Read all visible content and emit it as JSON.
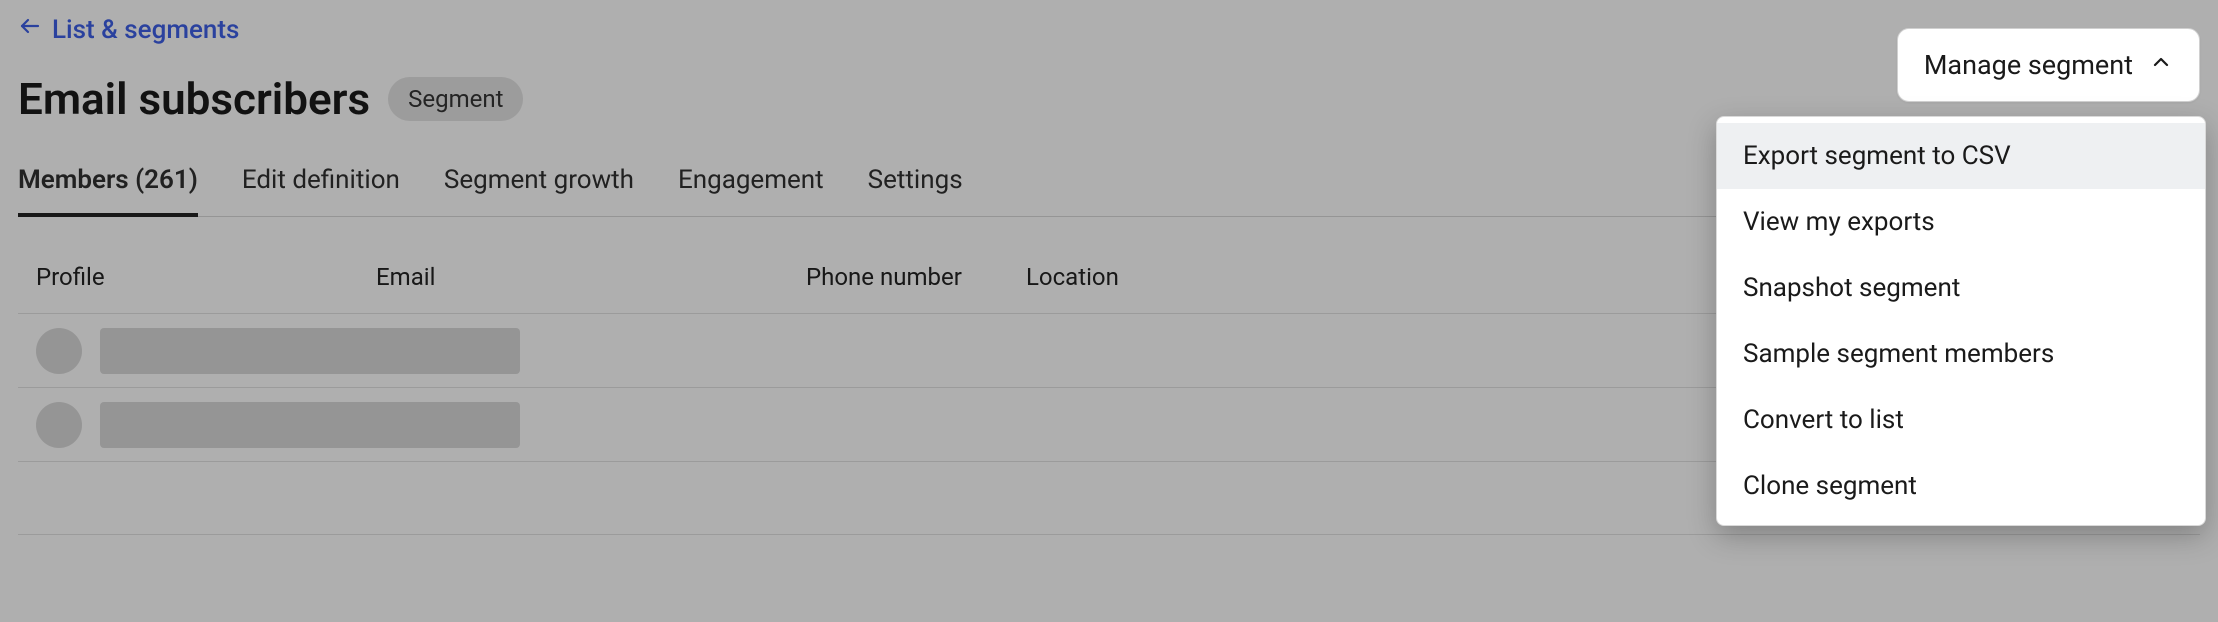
{
  "breadcrumb": {
    "label": "List & segments"
  },
  "header": {
    "title": "Email subscribers",
    "chip": "Segment"
  },
  "tabs": [
    {
      "label": "Members (261)",
      "active": true
    },
    {
      "label": "Edit definition",
      "active": false
    },
    {
      "label": "Segment growth",
      "active": false
    },
    {
      "label": "Engagement",
      "active": false
    },
    {
      "label": "Settings",
      "active": false
    }
  ],
  "table": {
    "columns": [
      "Profile",
      "Email",
      "Phone number",
      "Location"
    ]
  },
  "manage_button": {
    "label": "Manage segment"
  },
  "dropdown": {
    "items": [
      {
        "label": "Export segment to CSV",
        "highlight": true
      },
      {
        "label": "View my exports",
        "highlight": false
      },
      {
        "label": "Snapshot segment",
        "highlight": false
      },
      {
        "label": "Sample segment members",
        "highlight": false
      },
      {
        "label": "Convert to list",
        "highlight": false
      },
      {
        "label": "Clone segment",
        "highlight": false
      }
    ]
  }
}
